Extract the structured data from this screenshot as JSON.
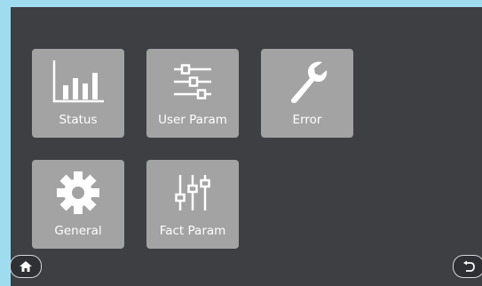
{
  "menu": {
    "tiles": [
      {
        "label": "Status",
        "icon": "bar-chart-icon"
      },
      {
        "label": "User Param",
        "icon": "sliders-icon"
      },
      {
        "label": "Error",
        "icon": "wrench-icon"
      },
      {
        "label": "General",
        "icon": "gear-icon"
      },
      {
        "label": "Fact Param",
        "icon": "equalizer-icon"
      }
    ]
  },
  "footer": {
    "home_icon": "home-icon",
    "back_icon": "back-icon"
  },
  "colors": {
    "screen_bg": "#3e3f43",
    "tile_bg": "#a3a3a3",
    "outer_bg": "#9fdcf0",
    "icon": "#ffffff"
  }
}
